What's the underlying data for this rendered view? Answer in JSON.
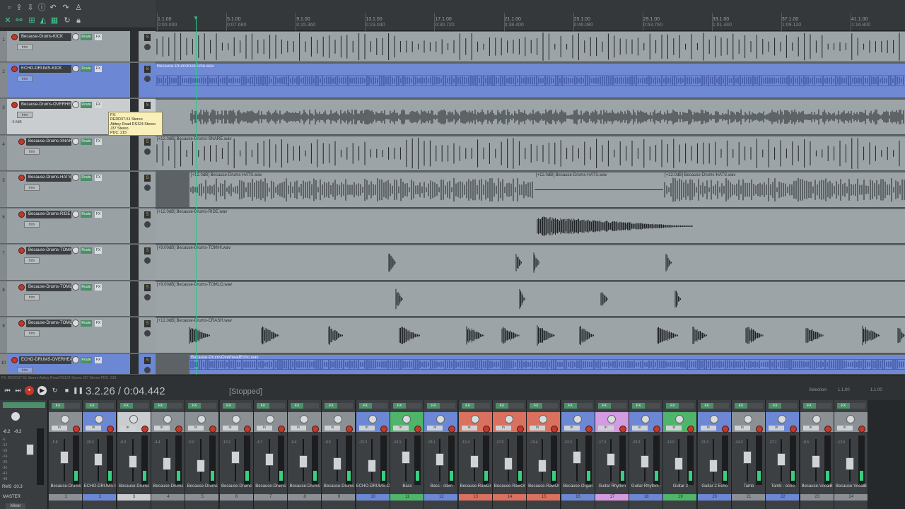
{
  "ruler": [
    {
      "bar": "1.1.00",
      "time": "0:00.000"
    },
    {
      "bar": "5.1.00",
      "time": "0:07.680"
    },
    {
      "bar": "9.1.00",
      "time": "0:15.360"
    },
    {
      "bar": "13.1.00",
      "time": "0:23.040"
    },
    {
      "bar": "17.1.00",
      "time": "0:30.720"
    },
    {
      "bar": "21.1.00",
      "time": "0:38.400"
    },
    {
      "bar": "25.1.00",
      "time": "0:46.080"
    },
    {
      "bar": "29.1.00",
      "time": "0:53.760"
    },
    {
      "bar": "33.1.00",
      "time": "1:01.440"
    },
    {
      "bar": "37.1.00",
      "time": "1:09.120"
    },
    {
      "bar": "41.1.00",
      "time": "1:16.800"
    }
  ],
  "tracks": [
    {
      "name": "Because-Drums-KICK",
      "num": "1",
      "env": "trim",
      "route": "Route",
      "fx": "FX"
    },
    {
      "name": "ECHO-DRUMS-KICK",
      "num": "2",
      "env": "trim",
      "route": "Route",
      "fx": "FX"
    },
    {
      "name": "Because-Drums-OVERHEAD",
      "num": "3",
      "env": "trim",
      "route": "Route",
      "fx": "FX",
      "vol": "-6.6dB"
    },
    {
      "name": "Because-Drums-SNARE",
      "num": "4",
      "env": "trim",
      "route": "Route",
      "fx": "FX"
    },
    {
      "name": "Because-Drums-HATS",
      "num": "5",
      "env": "trim",
      "route": "Route",
      "fx": "FX"
    },
    {
      "name": "Because-Drums-RIDE",
      "num": "6",
      "env": "trim",
      "route": "Route",
      "fx": "FX"
    },
    {
      "name": "Because-Drums-TOMHI",
      "num": "7",
      "env": "trim",
      "route": "Route",
      "fx": "FX"
    },
    {
      "name": "Because-Drums-TOMLO",
      "num": "8",
      "env": "trim",
      "route": "Route",
      "fx": "FX"
    },
    {
      "name": "Because-Drums-TOMLO",
      "num": "9",
      "env": "trim",
      "route": "Route",
      "fx": "FX"
    },
    {
      "name": "ECHO-DRUMS-OVERHEAD",
      "num": "10",
      "env": "trim",
      "route": "Route",
      "fx": "FX"
    }
  ],
  "items": [
    {
      "label": "",
      "lane": 0
    },
    {
      "label": "Because-DrumsKickEcho.wav",
      "lane": 1
    },
    {
      "label": "",
      "lane": 2
    },
    {
      "label": "[+12.0dB] Because-Drums-SNARE.wav",
      "lane": 3
    },
    {
      "label": "[+12.0dB] Because-Drums-HATS.wav",
      "lane": 4
    },
    {
      "label": "[+12.0dB] Because-Drums-HATS.wav",
      "lane": 4
    },
    {
      "label": "[+12.0dB] Because-Drums-HATS.wav",
      "lane": 4
    },
    {
      "label": "[+12.0dB] Because-Drums-RIDE.wav",
      "lane": 5
    },
    {
      "label": "[+9.00dB] Because-Drums-TOMHI.wav",
      "lane": 6
    },
    {
      "label": "[+9.00dB] Because-Drums-TOMLO.wav",
      "lane": 7
    },
    {
      "label": "[+12.0dB] Because-Drums-CRASH.wav",
      "lane": 8
    },
    {
      "label": "Because-DrumsOverheadEcho.wav",
      "lane": 9
    }
  ],
  "tooltip": {
    "line1": "FX:",
    "line2": "REDD37-51 Stereo",
    "line3": "Abbey Road RS124 Stereo",
    "line4": "J37 Stereo",
    "line5": "PDC: 215"
  },
  "transport": {
    "fx_line": "FX: REDD37-51 Stereo   Abbey Road RS124 Stereo   J37 Stereo PDC: 215",
    "time": "3.2.26 / 0:04.442",
    "status": "[Stopped]",
    "selection_label": "Selection:",
    "selection_start": "1.1.00",
    "selection_end": "1.1.00"
  },
  "master": {
    "label": "MASTER",
    "rms": "RMS  -20.3",
    "peak_l": "-8.2",
    "peak_r": "-8.2",
    "scale": [
      "-6",
      "-12",
      "-18",
      "-24",
      "-30",
      "-36",
      "-42",
      "-48"
    ]
  },
  "strips": [
    {
      "name": "Because-Drums",
      "idx": "1",
      "color": "#8a9094",
      "val": "-5.8"
    },
    {
      "name": "ECHO-DRUMS-I",
      "idx": "2",
      "color": "#6c87d3",
      "val": "-20.3"
    },
    {
      "name": "Because-Drums",
      "idx": "3",
      "color": "#c9cdd0",
      "val": "-8.3"
    },
    {
      "name": "Because-Drums",
      "idx": "4",
      "color": "#8a9094",
      "val": "-4.4"
    },
    {
      "name": "Because-Drums",
      "idx": "5",
      "color": "#8a9094",
      "val": "-5.0"
    },
    {
      "name": "Because-Drums",
      "idx": "6",
      "color": "#8a9094",
      "val": "-12.2"
    },
    {
      "name": "Because-Drums",
      "idx": "7",
      "color": "#8a9094",
      "val": "-6.7"
    },
    {
      "name": "Because-Drums",
      "idx": "8",
      "color": "#8a9094",
      "val": "-6.4"
    },
    {
      "name": "Because-Drums",
      "idx": "9",
      "color": "#8a9094",
      "val": "-9.5"
    },
    {
      "name": "ECHO-DRUMS-O",
      "idx": "10",
      "color": "#6c87d3",
      "val": "-22.2"
    },
    {
      "name": "Bass",
      "idx": "11",
      "color": "#4fb56a",
      "val": "-13.1"
    },
    {
      "name": "Bass - stem",
      "idx": "12",
      "color": "#6c87d3",
      "val": "-23.1"
    },
    {
      "name": "Because-RawOr",
      "idx": "13",
      "color": "#d9715e",
      "val": "-13.4"
    },
    {
      "name": "Because-RawOr",
      "idx": "14",
      "color": "#d9715e",
      "val": "-17.5"
    },
    {
      "name": "Because-RawOr",
      "idx": "15",
      "color": "#d9715e",
      "val": "-13.4"
    },
    {
      "name": "Because-Organ",
      "idx": "16",
      "color": "#6c87d3",
      "val": "-23.3"
    },
    {
      "name": "Guitar Rhythm",
      "idx": "17",
      "color": "#d39be0",
      "val": "-17.3"
    },
    {
      "name": "Guitar Rhythm -",
      "idx": "18",
      "color": "#6c87d3",
      "val": "-23.3"
    },
    {
      "name": "Guitar 2",
      "idx": "19",
      "color": "#4fb56a",
      "val": "-13.0"
    },
    {
      "name": "Guitar 2 Echo",
      "idx": "20",
      "color": "#6c87d3",
      "val": "-21.3"
    },
    {
      "name": "Tamb",
      "idx": "21",
      "color": "#8a9094",
      "val": "-14.3"
    },
    {
      "name": "Tamb - echo",
      "idx": "22",
      "color": "#6c87d3",
      "val": "-27.1"
    },
    {
      "name": "Because-VocalB",
      "idx": "23",
      "color": "#8a9094",
      "val": "-8.5"
    },
    {
      "name": "Because-VocalB",
      "idx": "24",
      "color": "#8a9094",
      "val": "-12.6"
    }
  ],
  "mixer_tab": "Mixer",
  "labels": {
    "in": "in",
    "fx": "FX"
  }
}
